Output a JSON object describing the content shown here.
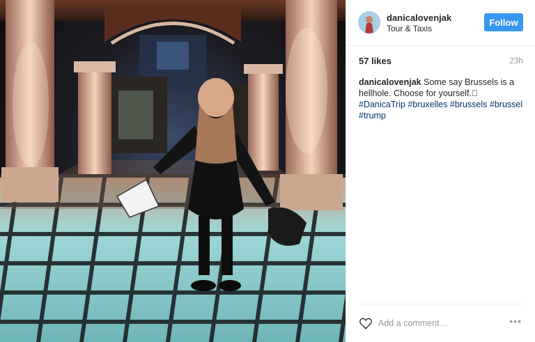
{
  "post": {
    "image_alt": "Woman standing on illuminated glass floor in arcade"
  },
  "header": {
    "username": "danicalovenjak",
    "location": "Tour & Taxis",
    "follow_label": "Follow"
  },
  "stats": {
    "likes": "57 likes",
    "time_ago": "23h"
  },
  "caption": {
    "username": "danicalovenjak",
    "text": "Some say Brussels is a hellhole. Choose for yourself.",
    "emoji": "⃞",
    "hashtags": [
      "#DanicaTrip",
      "#bruxelles",
      "#brussels",
      "#brussel",
      "#trump"
    ]
  },
  "comment": {
    "placeholder": "Add a comment…",
    "more_label": "•••"
  },
  "colors": {
    "follow_bg": "#3897f0",
    "hashtag": "#003569",
    "muted": "#999999"
  }
}
